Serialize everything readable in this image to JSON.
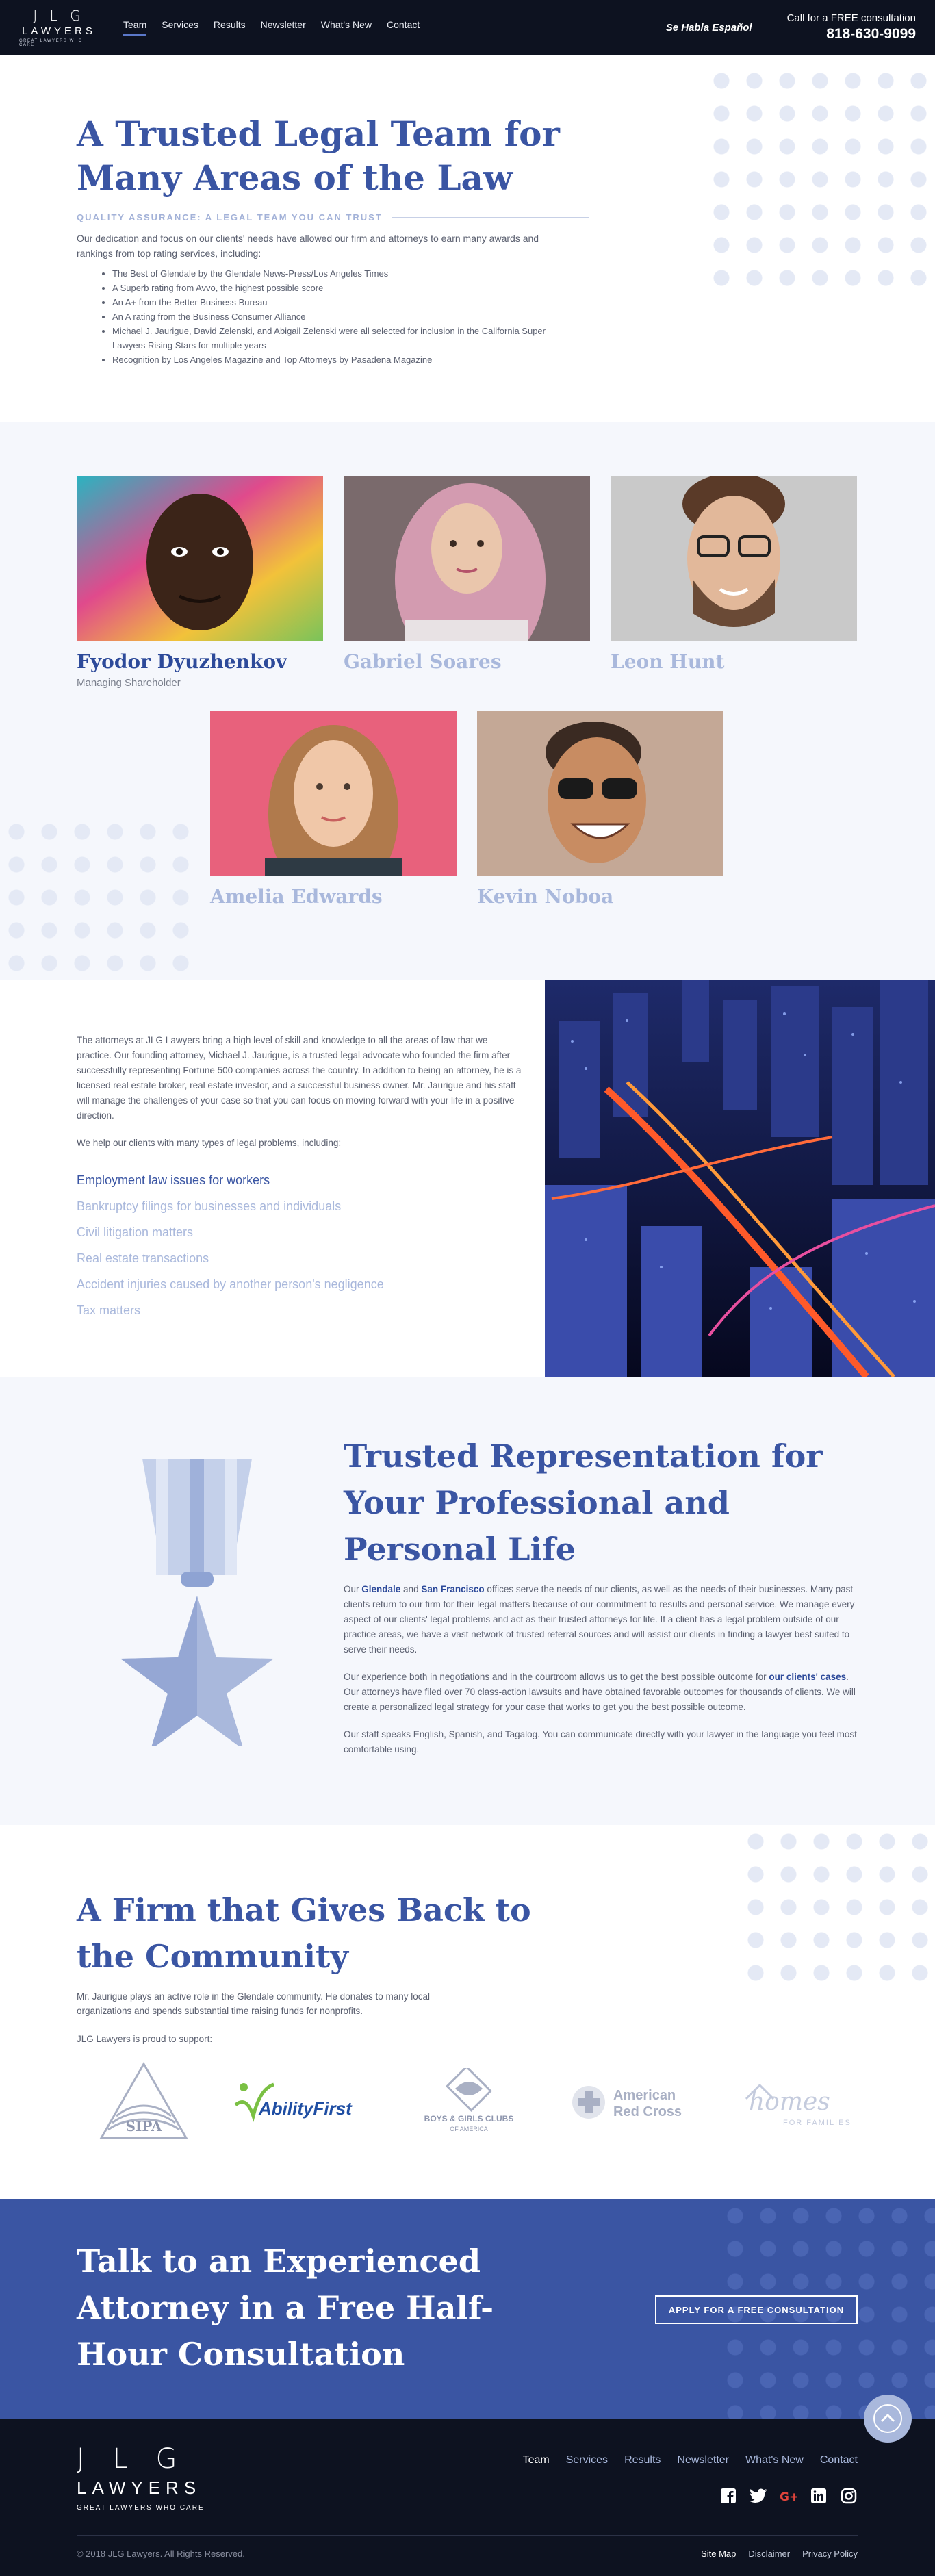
{
  "header": {
    "logo_letters": "J L G",
    "logo_word": "LAWYERS",
    "logo_tag": "GREAT LAWYERS WHO CARE",
    "nav": [
      "Team",
      "Services",
      "Results",
      "Newsletter",
      "What's New",
      "Contact"
    ],
    "habla": "Se Habla Español",
    "cta_text": "Call for a FREE consultation",
    "cta_phone": "818-630-9099"
  },
  "intro": {
    "title": "A Trusted Legal Team for Many Areas of the Law",
    "subtitle": "QUALITY ASSURANCE: A LEGAL TEAM YOU CAN TRUST",
    "paragraph": "Our dedication and focus on our clients' needs have allowed our firm and attorneys to earn many awards and rankings from top rating services, including:",
    "awards": [
      "The Best of Glendale by the Glendale News-Press/Los Angeles Times",
      "A Superb rating from Avvo, the highest possible score",
      "An A+ from the Better Business Bureau",
      "An A rating from the Business Consumer Alliance",
      "Michael J. Jaurigue, David Zelenski, and Abigail Zelenski were all selected for inclusion in the California Super Lawyers Rising Stars for multiple years",
      "Recognition by Los Angeles Magazine and Top Attorneys by Pasadena Magazine"
    ]
  },
  "team": {
    "members": [
      {
        "name": "Fyodor Dyuzhenkov",
        "role": "Managing Shareholder"
      },
      {
        "name": "Gabriel Soares",
        "role": ""
      },
      {
        "name": "Leon Hunt",
        "role": ""
      },
      {
        "name": "Amelia Edwards",
        "role": ""
      },
      {
        "name": "Kevin Noboa",
        "role": ""
      }
    ]
  },
  "practice": {
    "paragraph1": "The attorneys at JLG Lawyers bring a high level of skill and knowledge to all the areas of law that we practice. Our founding attorney, Michael J. Jaurigue, is a trusted legal advocate who founded the firm after successfully representing Fortune 500 companies across the country. In addition to being an attorney, he is a licensed real estate broker, real estate investor, and a successful business owner. Mr. Jaurigue and his staff will manage the challenges of your case so that you can focus on moving forward with your life in a positive direction.",
    "paragraph2": "We help our clients with many types of legal problems, including:",
    "areas": [
      "Employment law issues for workers",
      "Bankruptcy filings for businesses and individuals",
      "Civil litigation matters",
      "Real estate transactions",
      "Accident injuries caused by another person's negligence",
      "Tax matters"
    ]
  },
  "representation": {
    "title": "Trusted Representation for Your Professional and Personal Life",
    "p1_a": "Our ",
    "p1_link1": "Glendale",
    "p1_b": " and ",
    "p1_link2": "San Francisco",
    "p1_c": " offices serve the needs of our clients, as well as the needs of their businesses. Many past clients return to our firm for their legal matters because of our commitment to results and personal service. We manage every aspect of our clients' legal problems and act as their trusted attorneys for life. If a client has a legal problem outside of our practice areas, we have a vast network of trusted referral sources and will assist our clients in finding a lawyer best suited to serve their needs.",
    "p2_a": "Our experience both in negotiations and in the courtroom allows us to get the best possible outcome for ",
    "p2_link": "our clients' cases",
    "p2_b": ". Our attorneys have filed over 70 class-action lawsuits and have obtained favorable outcomes for thousands of clients. We will create a personalized legal strategy for your case that works to get you the best possible outcome.",
    "p3": "Our staff speaks English, Spanish, and Tagalog. You can communicate directly with your lawyer in the language you feel most comfortable using."
  },
  "community": {
    "title": "A Firm that Gives Back to the Community",
    "paragraph": "Mr. Jaurigue plays an active role in the Glendale community. He donates to many local organizations and spends substantial time raising funds for nonprofits.",
    "support": "JLG Lawyers is proud to support:",
    "orgs": {
      "sipa": "SIPA",
      "ability_first": "AbilityFirst",
      "bgc_line1": "BOYS & GIRLS CLUBS",
      "bgc_line2": "OF AMERICA",
      "red_cross_line1": "American",
      "red_cross_line2": "Red Cross",
      "homes_word": "homes",
      "homes_sub": "FOR FAMILIES"
    }
  },
  "consult": {
    "title": "Talk to an Experienced Attorney in a Free Half-Hour Consultation",
    "button": "APPLY FOR A FREE CONSULTATION"
  },
  "footer": {
    "logo_letters": "J L G",
    "logo_word": "LAWYERS",
    "logo_tag": "GREAT LAWYERS WHO CARE",
    "nav": [
      "Team",
      "Services",
      "Results",
      "Newsletter",
      "What's New",
      "Contact"
    ],
    "socials": [
      "facebook-icon",
      "twitter-icon",
      "google-plus-icon",
      "linkedin-icon",
      "instagram-icon"
    ],
    "copyright": "© 2018 JLG Lawyers. All Rights Reserved.",
    "legal": [
      "Site Map",
      "Disclaimer",
      "Privacy Policy"
    ]
  },
  "colors": {
    "navy": "#0d1220",
    "brand_blue": "#3a55a3",
    "light_blue": "#a9b8dc",
    "pale_bg": "#f5f7fc"
  }
}
